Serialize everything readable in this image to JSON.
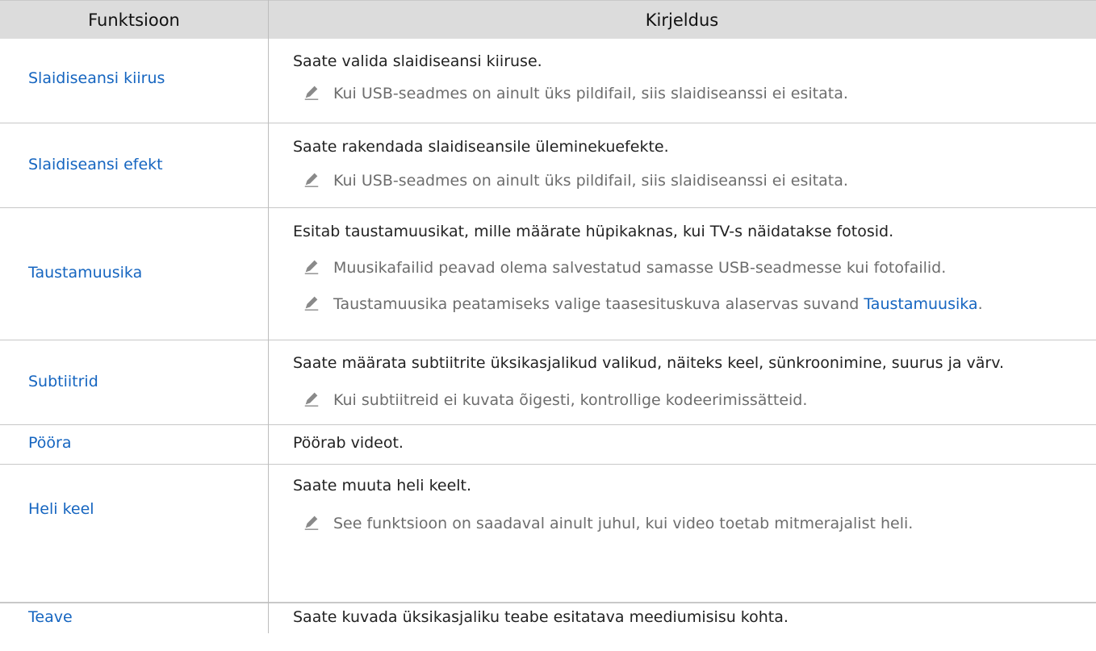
{
  "header": {
    "col1": "Funktsioon",
    "col2": "Kirjeldus"
  },
  "rows": [
    {
      "function": "Slaidiseansi kiirus",
      "description": "Saate valida slaidiseansi kiiruse.",
      "notes": [
        "Kui USB-seadmes on ainult üks pildifail, siis slaidiseanssi ei esitata."
      ]
    },
    {
      "function": "Slaidiseansi efekt",
      "description": "Saate rakendada slaidiseansile üleminekuefekte.",
      "notes": [
        "Kui USB-seadmes on ainult üks pildifail, siis slaidiseanssi ei esitata."
      ]
    },
    {
      "function": "Taustamuusika",
      "description": "Esitab taustamuusikat, mille määrate hüpikaknas, kui TV-s näidatakse fotosid.",
      "notes": [
        "Muusikafailid peavad olema salvestatud samasse USB-seadmesse kui fotofailid.",
        "Taustamuusika peatamiseks valige taasesituskuva alaservas suvand "
      ],
      "note_link": "Taustamuusika",
      "note_link_suffix": "."
    },
    {
      "function": "Subtiitrid",
      "description": "Saate määrata subtiitrite üksikasjalikud valikud, näiteks keel, sünkroonimine, suurus ja värv.",
      "notes": [
        "Kui subtiitreid ei kuvata õigesti, kontrollige kodeerimissätteid."
      ]
    },
    {
      "function": "Pööra",
      "description": "Pöörab videot.",
      "notes": []
    },
    {
      "function": "Heli keel",
      "description": "Saate muuta heli keelt.",
      "notes": [
        "See funktsioon on saadaval ainult juhul, kui video toetab mitmerajalist heli."
      ]
    },
    {
      "function": "Teave",
      "description": "Saate kuvada üksikasjaliku teabe esitatava meediumisisu kohta.",
      "notes": []
    }
  ],
  "icons": {
    "note": "pencil-note-icon"
  },
  "colors": {
    "link": "#1565c0",
    "header_bg": "#dcdcdc",
    "note_text": "#6d6d6d"
  }
}
